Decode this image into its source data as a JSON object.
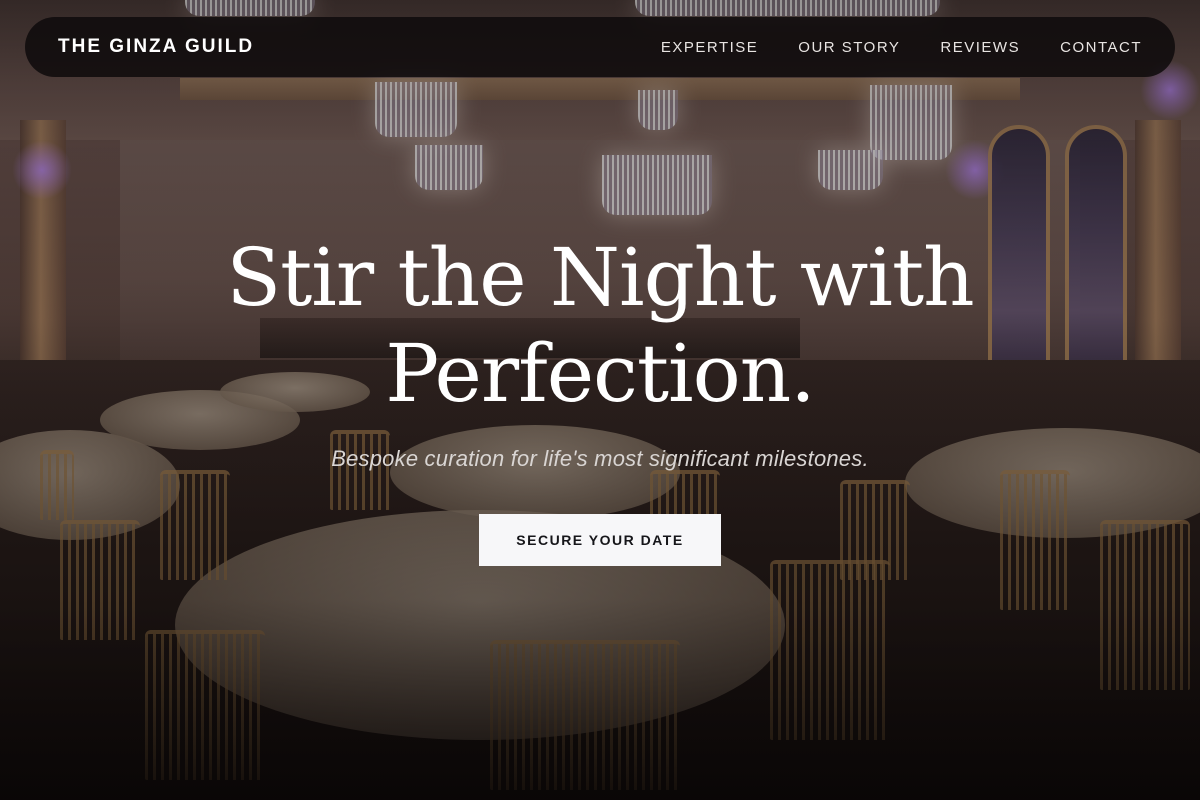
{
  "brand": {
    "name": "THE GINZA GUILD"
  },
  "nav": {
    "links": [
      {
        "label": "EXPERTISE"
      },
      {
        "label": "OUR STORY"
      },
      {
        "label": "REVIEWS"
      },
      {
        "label": "CONTACT"
      }
    ]
  },
  "hero": {
    "headline_line1": "Stir the Night with",
    "headline_line2": "Perfection.",
    "subtitle": "Bespoke curation for life's most significant milestones.",
    "cta_label": "SECURE YOUR DATE",
    "background_image": "banquet-hall-photo"
  },
  "colors": {
    "navbar_bg": "#0e0b0c",
    "text_primary": "#ffffff",
    "cta_bg": "#f7f7f9",
    "cta_text": "#16161a"
  }
}
